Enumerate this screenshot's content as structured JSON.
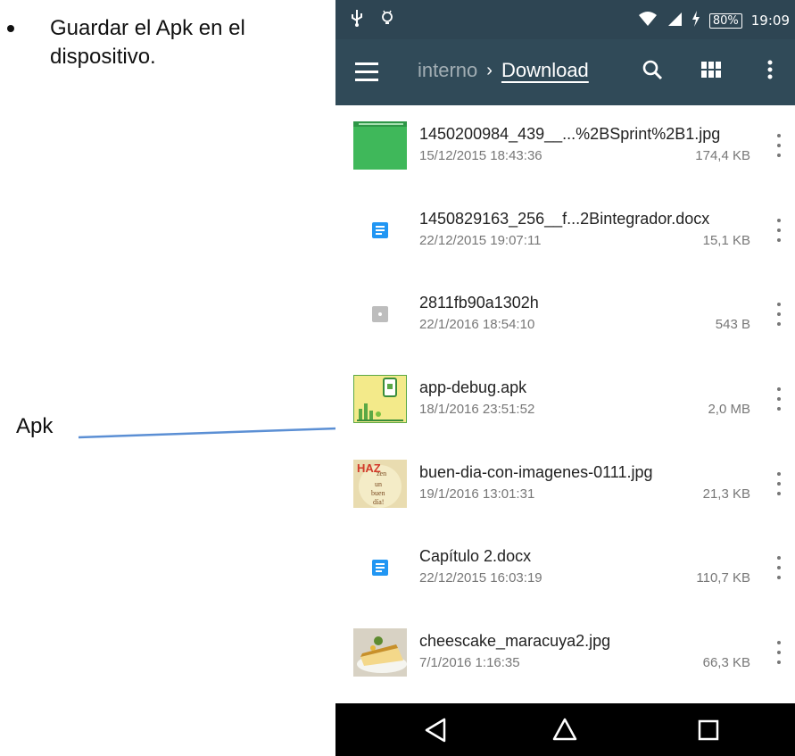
{
  "document": {
    "bullet_text": "Guardar el Apk en el dispositivo.",
    "arrow_label": "Apk"
  },
  "status_bar": {
    "battery": "80%",
    "time": "19:09"
  },
  "toolbar": {
    "breadcrumb_prev": "interno",
    "breadcrumb_sep": "›",
    "breadcrumb_current": "Download"
  },
  "files": [
    {
      "name": "1450200984_439__...%2BSprint%2B1.jpg",
      "date": "15/12/2015 18:43:36",
      "size": "174,4 KB",
      "icon": "green-image-thumbnail"
    },
    {
      "name": "1450829163_256__f...2Bintegrador.docx",
      "date": "22/12/2015 19:07:11",
      "size": "15,1 KB",
      "icon": "document-icon"
    },
    {
      "name": "2811fb90a1302h",
      "date": "22/1/2016 18:54:10",
      "size": "543 B",
      "icon": "generic-file-icon"
    },
    {
      "name": "app-debug.apk",
      "date": "18/1/2016 23:51:52",
      "size": "2,0 MB",
      "icon": "apk-thumbnail"
    },
    {
      "name": "buen-dia-con-imagenes-0111.jpg",
      "date": "19/1/2016 13:01:31",
      "size": "21,3 KB",
      "icon": "image-thumbnail"
    },
    {
      "name": "Capítulo 2.docx",
      "date": "22/12/2015 16:03:19",
      "size": "110,7 KB",
      "icon": "document-icon"
    },
    {
      "name": "cheescake_maracuya2.jpg",
      "date": "7/1/2016 1:16:35",
      "size": "66,3 KB",
      "icon": "image-thumbnail"
    }
  ],
  "thumb_text": {
    "line1": "HAZ",
    "line2": "zen",
    "line3": "un",
    "line4": "buen",
    "line5": "día!"
  },
  "colors": {
    "status_bar": "#2e4553",
    "toolbar": "#304a58",
    "doc_icon": "#2196f3",
    "green_thumb": "#3fb85a",
    "arrow": "#5b8fd4"
  }
}
